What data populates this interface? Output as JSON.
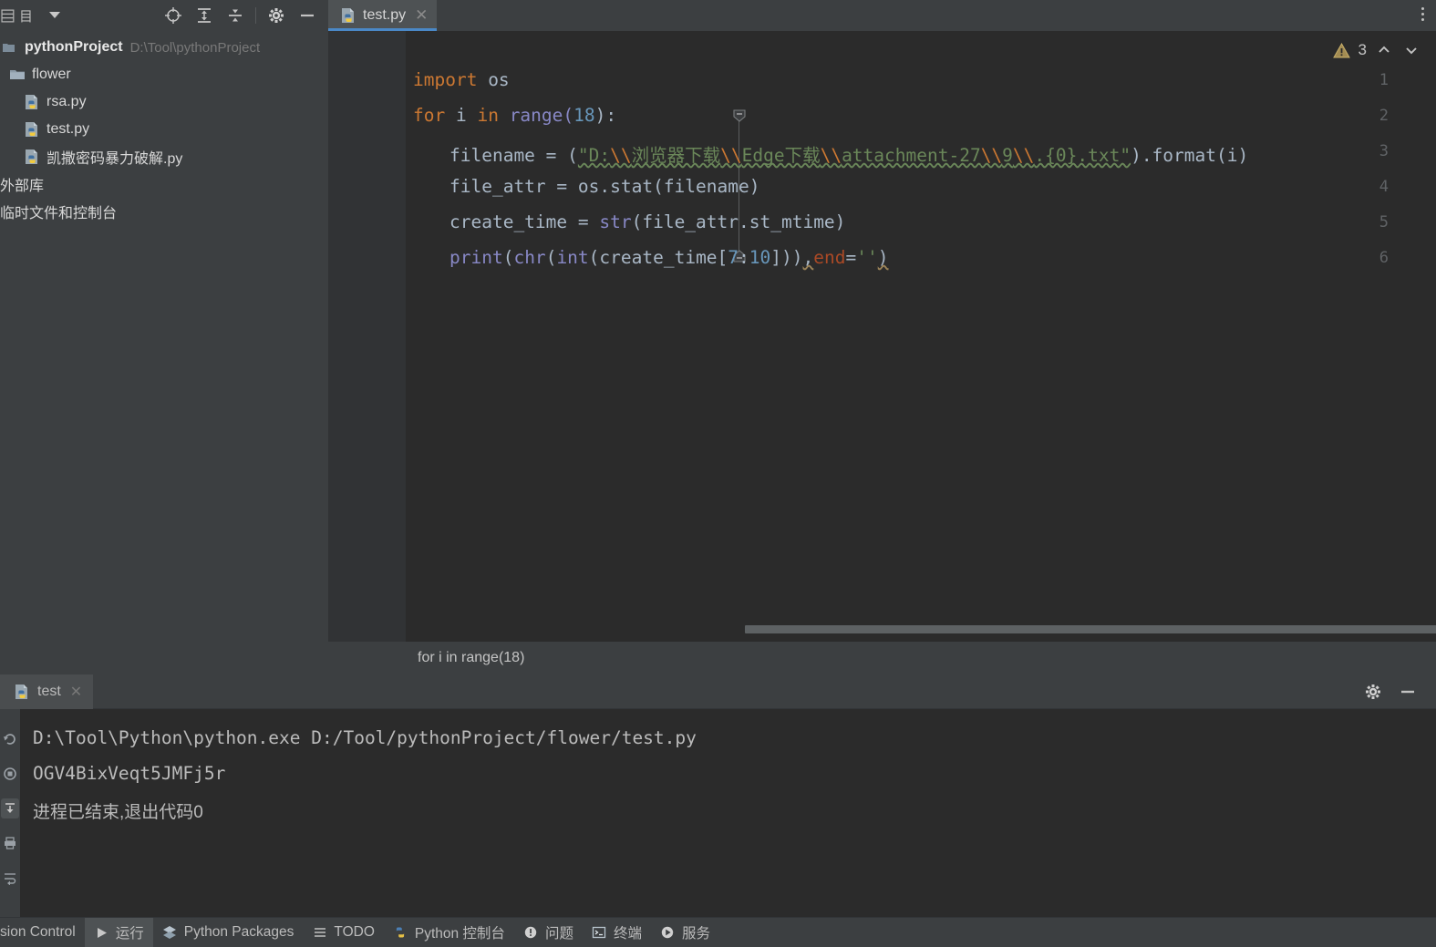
{
  "window": {
    "theme_bg": "#3c3f41",
    "editor_bg": "#2b2b2b",
    "accent": "#4a88c7"
  },
  "project_panel": {
    "title": "目",
    "icons": [
      {
        "name": "locate-icon",
        "glyph": "locate"
      },
      {
        "name": "expand-all-icon",
        "glyph": "expand-all"
      },
      {
        "name": "collapse-all-icon",
        "glyph": "collapse-all"
      },
      {
        "name": "gear-icon",
        "glyph": "gear"
      },
      {
        "name": "minimize-icon",
        "glyph": "minimize"
      }
    ],
    "tree": [
      {
        "label": "pythonProject",
        "sub": "D:\\Tool\\pythonProject",
        "kind": "root",
        "icon": "project-icon"
      },
      {
        "label": "flower",
        "sub": "",
        "kind": "folder",
        "icon": "folder-icon"
      },
      {
        "label": "rsa.py",
        "sub": "",
        "kind": "file",
        "icon": "python-file-icon"
      },
      {
        "label": "test.py",
        "sub": "",
        "kind": "file",
        "icon": "python-file-icon"
      },
      {
        "label": "凯撒密码暴力破解.py",
        "sub": "",
        "kind": "file",
        "icon": "python-file-icon"
      },
      {
        "label": "外部库",
        "sub": "",
        "kind": "ext",
        "icon": "library-icon"
      },
      {
        "label": "临时文件和控制台",
        "sub": "",
        "kind": "ext",
        "icon": "scratches-icon"
      }
    ]
  },
  "editor": {
    "tab": {
      "name": "test.py",
      "close": "✕",
      "icon": "python-file-icon"
    },
    "inspection": {
      "warning_count": "3",
      "icon": "warning-triangle-icon"
    },
    "line_numbers": [
      "1",
      "2",
      "3",
      "4",
      "5",
      "6"
    ],
    "code": {
      "l1_kw": "import",
      "l1_rest": " os",
      "l2_kw": "for",
      "l2_var": " i ",
      "l2_in": "in",
      "l2_call": " range(",
      "l2_num": "18",
      "l2_end": "):",
      "l3_a": "filename = (",
      "l3_str1": "\"D:",
      "l3_esc1": "\\\\",
      "l3_str2": "浏览器下载",
      "l3_esc2": "\\\\",
      "l3_str3": "Edge下载",
      "l3_esc3": "\\\\",
      "l3_str4": "attachment-27",
      "l3_esc4": "\\\\",
      "l3_str5": "9",
      "l3_esc5": "\\\\",
      "l3_str6": ".{0}.txt\"",
      "l3_b": ").format(i)",
      "l4": "file_attr = os.stat(filename)",
      "l4_a": "file_attr = os.",
      "l4_fn": "stat",
      "l4_b": "(filename)",
      "l5_a": "create_time = ",
      "l5_fn": "str",
      "l5_b": "(file_attr.st_mtime)",
      "l6_fn1": "print",
      "l6_p1": "(",
      "l6_fn2": "chr",
      "l6_p2": "(",
      "l6_fn3": "int",
      "l6_p3": "(create_time[",
      "l6_n1": "7",
      "l6_c": ":",
      "l6_n2": "10",
      "l6_p4": "]))",
      "l6_comma": ",",
      "l6_kwarg": "end",
      "l6_eq": "=",
      "l6_str": "''",
      "l6_p5": ")"
    },
    "breadcrumb": "for i in range(18)"
  },
  "run_panel": {
    "tab": {
      "label": "test",
      "close": "✕",
      "icon": "python-file-icon"
    },
    "tools": [
      {
        "name": "gear-icon",
        "glyph": "gear"
      },
      {
        "name": "minimize-icon",
        "glyph": "minimize"
      }
    ],
    "gutter_buttons": [
      {
        "name": "rerun-icon",
        "glyph": "rerun"
      },
      {
        "name": "stop-icon",
        "glyph": "stop"
      },
      {
        "name": "scroll-to-end-icon",
        "glyph": "scroll-end",
        "selected": true
      },
      {
        "name": "print-icon",
        "glyph": "print"
      },
      {
        "name": "soft-wrap-icon",
        "glyph": "wrap"
      }
    ],
    "output": [
      "D:\\Tool\\Python\\python.exe D:/Tool/pythonProject/flower/test.py",
      "OGV4BixVeqt5JMFj5r",
      "进程已结束,退出代码0"
    ]
  },
  "statusbar": {
    "items": [
      {
        "label": "sion Control",
        "icon": "",
        "active": false
      },
      {
        "label": "运行",
        "icon": "run-icon",
        "active": true
      },
      {
        "label": "Python Packages",
        "icon": "packages-icon",
        "active": false
      },
      {
        "label": "TODO",
        "icon": "todo-icon",
        "active": false
      },
      {
        "label": "Python 控制台",
        "icon": "python-console-icon",
        "active": false
      },
      {
        "label": "问题",
        "icon": "problems-icon",
        "active": false
      },
      {
        "label": "终端",
        "icon": "terminal-icon",
        "active": false
      },
      {
        "label": "服务",
        "icon": "services-icon",
        "active": false
      }
    ]
  }
}
